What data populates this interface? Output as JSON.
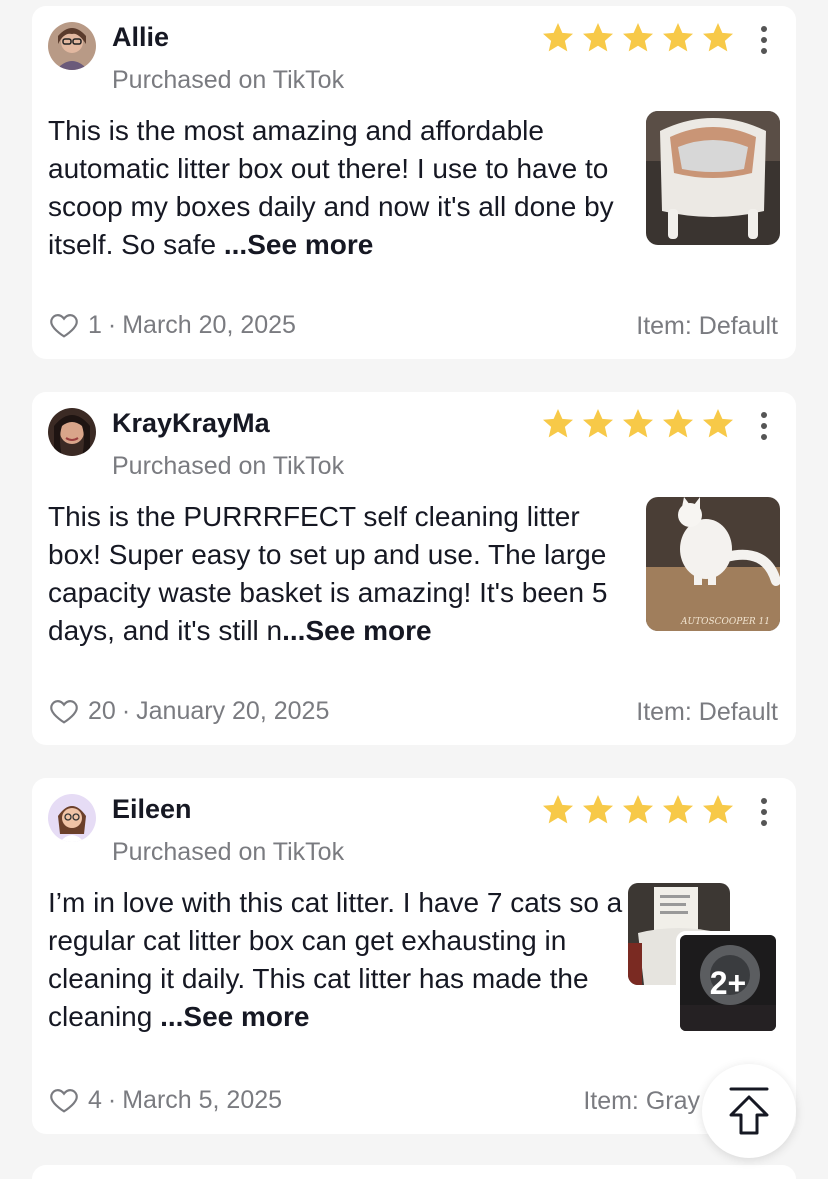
{
  "reviews": [
    {
      "username": "Allie",
      "source": "Purchased on TikTok",
      "rating": 5,
      "text": "This is the most amazing and affordable automatic litter box out there! I use to have to scoop my boxes daily and now it's all done by itself. So safe ",
      "see_more": "...See more",
      "likes": "1",
      "date": "March 20, 2025",
      "item": "Item: Default",
      "image_count_badge": ""
    },
    {
      "username": "KrayKrayMa",
      "source": "Purchased on TikTok",
      "rating": 5,
      "text": "This is the PURRRFECT self cleaning litter box! Super easy to set up and use. The large capacity waste basket is amazing! It's been 5 days, and it's still n",
      "see_more": "...See more",
      "likes": "20",
      "date": "January 20, 2025",
      "item": "Item: Default",
      "image_text": "AUTOSCOOPER 11",
      "image_count_badge": ""
    },
    {
      "username": "Eileen",
      "source": "Purchased on TikTok",
      "rating": 5,
      "text": "I’m in love with this cat litter. I have 7 cats so a regular cat litter box can get exhausting in cleaning it daily. This cat litter has made the cleaning ",
      "see_more": "...See more",
      "likes": "4",
      "date": "March 5, 2025",
      "item": "Item: Gray",
      "image_count_badge": "2+"
    }
  ],
  "separator": "·",
  "colors": {
    "star": "#f7c948",
    "muted_text": "#7a7b80",
    "card_bg": "#ffffff",
    "page_bg": "#f5f5f5"
  },
  "icons": {
    "star": "star-icon",
    "heart": "heart-outline-icon",
    "more": "more-vertical-icon",
    "scroll_top": "arrow-up-to-top-icon"
  }
}
